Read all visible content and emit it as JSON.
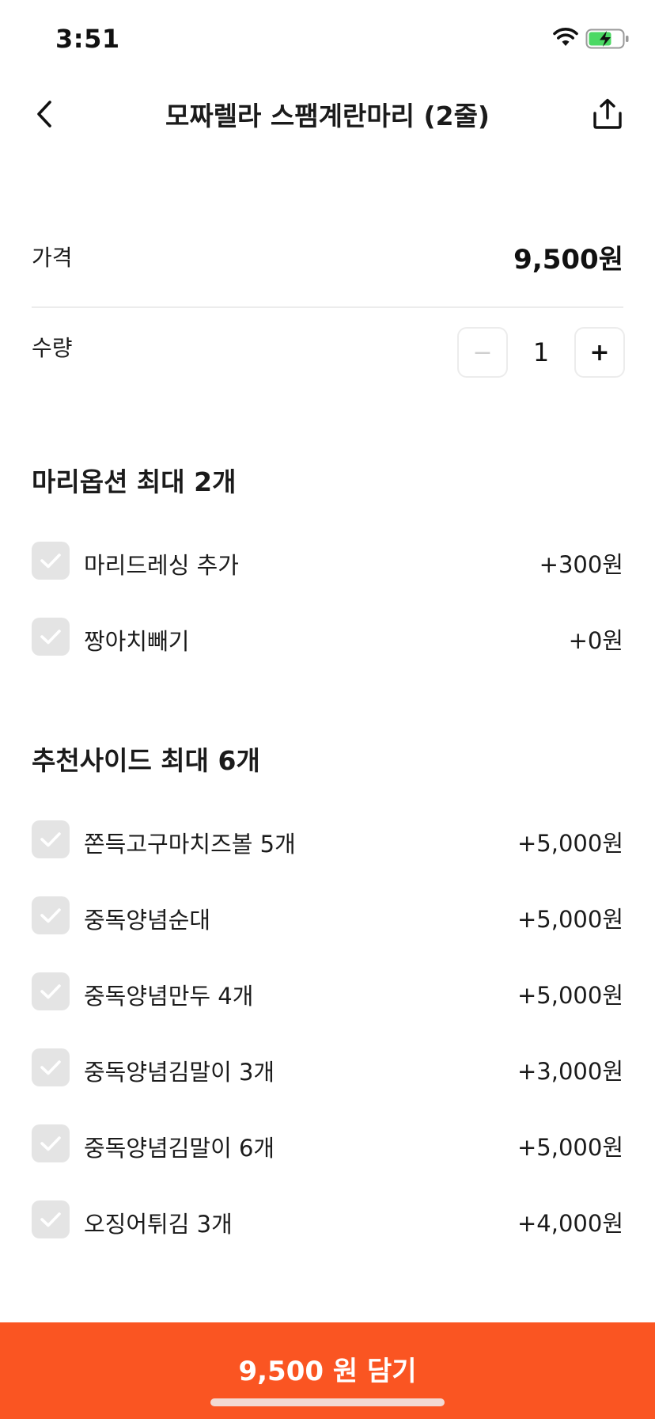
{
  "status_bar": {
    "time": "3:51"
  },
  "header": {
    "title": "모짜렐라 스팸계란마리 (2줄)"
  },
  "price": {
    "label": "가격",
    "value": "9,500원"
  },
  "quantity": {
    "label": "수량",
    "value": "1",
    "minus": "−",
    "plus": "+"
  },
  "sections": [
    {
      "title": "마리옵션 최대 2개",
      "options": [
        {
          "label": "마리드레싱 추가",
          "price": "+300원",
          "checked": false
        },
        {
          "label": "짱아치빼기",
          "price": "+0원",
          "checked": false
        }
      ]
    },
    {
      "title": "추천사이드 최대 6개",
      "options": [
        {
          "label": "쫀득고구마치즈볼 5개",
          "price": "+5,000원",
          "checked": false
        },
        {
          "label": "중독양념순대",
          "price": "+5,000원",
          "checked": false
        },
        {
          "label": "중독양념만두 4개",
          "price": "+5,000원",
          "checked": false
        },
        {
          "label": "중독양념김말이 3개",
          "price": "+3,000원",
          "checked": false
        },
        {
          "label": "중독양념김말이 6개",
          "price": "+5,000원",
          "checked": false
        },
        {
          "label": "오징어튀김 3개",
          "price": "+4,000원",
          "checked": false
        }
      ]
    }
  ],
  "cta": {
    "label": "9,500 원 담기"
  },
  "colors": {
    "accent": "#fa5522",
    "checkbox_bg": "#e4e4e4",
    "battery_green": "#4cd964"
  }
}
